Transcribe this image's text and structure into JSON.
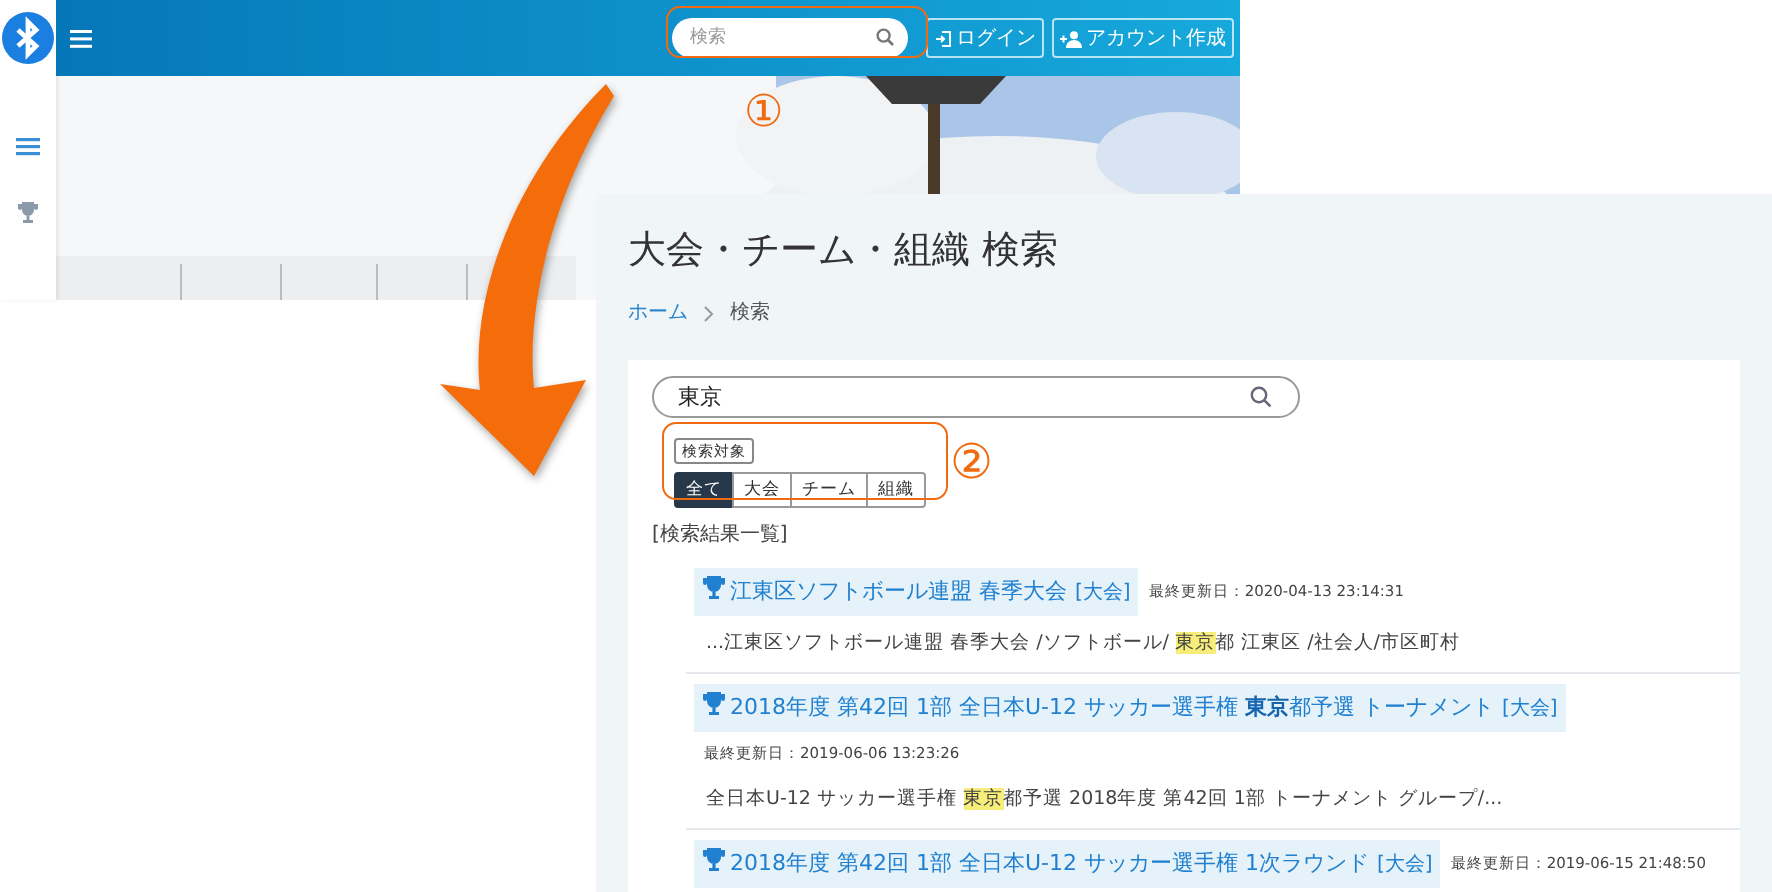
{
  "header": {
    "search": {
      "placeholder": "検索"
    },
    "buttons": [
      {
        "kind": "login",
        "label": "ログイン"
      },
      {
        "kind": "signup",
        "label": "アカウント作成"
      }
    ]
  },
  "annotations": [
    {
      "label": "①"
    },
    {
      "label": "②"
    }
  ],
  "page": {
    "title": "大会・チーム・組織 検索",
    "breadcrumb": [
      "ホーム",
      "検索"
    ],
    "search": {
      "value": "東京"
    },
    "filter_label": "検索対象",
    "filters": [
      {
        "label": "全て",
        "selected": true
      },
      {
        "label": "大会",
        "selected": false
      },
      {
        "label": "チーム",
        "selected": false
      },
      {
        "label": "組織",
        "selected": false
      }
    ],
    "results_heading": "[検索結果一覧]",
    "results": [
      {
        "title": "江東区ソフトボール連盟 春季大会",
        "tag": "[大会]",
        "updated": "最終更新日：2020-04-13 23:14:31",
        "snippet": [
          {
            "text": "...江東区ソフトボール連盟 春季大会 /ソフトボール/ ",
            "highlight": false
          },
          {
            "text": "東京",
            "highlight": true
          },
          {
            "text": "都 江東区 /社会人/市区町村",
            "highlight": false
          }
        ]
      },
      {
        "title": "2018年度 第42回 1部 全日本U-12 サッカー選手権 **東京**都予選 トーナメント",
        "tag": "[大会]",
        "updated": "最終更新日：2019-06-06 13:23:26",
        "snippet": [
          {
            "text": "全日本U-12 サッカー選手権 ",
            "highlight": false
          },
          {
            "text": "東京",
            "highlight": true
          },
          {
            "text": "都予選 2018年度 第42回 1部 トーナメント グループ/...",
            "highlight": false
          }
        ]
      },
      {
        "title": "2018年度 第42回 1部 全日本U-12 サッカー選手権 1次ラウンド",
        "tag": "[大会]",
        "updated": "最終更新日：2019-06-15 21:48:50"
      }
    ]
  }
}
